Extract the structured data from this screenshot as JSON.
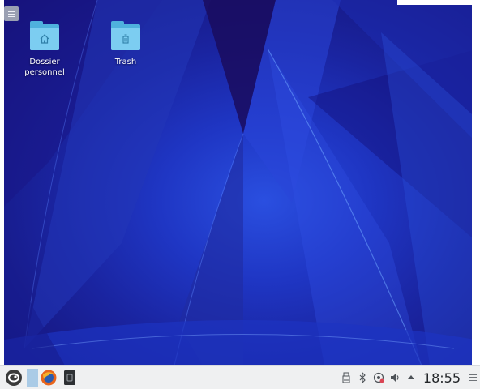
{
  "desktop": {
    "icons": [
      {
        "name": "Dossier personnel",
        "line1": "Dossier",
        "line2": "personnel",
        "icon": "home-icon"
      },
      {
        "name": "Trash",
        "line1": "Trash",
        "line2": "",
        "icon": "trash-icon"
      }
    ],
    "colors": {
      "folder": "#4fb1dd",
      "folder_front": "#7ccdf1",
      "wallpaper_base": "#1f36c4"
    }
  },
  "taskbar": {
    "launcher_icon": "opensuse-menu-icon",
    "apps": [
      {
        "name": "firefox",
        "icon": "firefox-icon"
      },
      {
        "name": "terminal",
        "icon": "terminal-icon"
      }
    ],
    "tray": [
      {
        "name": "storage",
        "icon": "storage-icon"
      },
      {
        "name": "bluetooth",
        "icon": "bluetooth-icon"
      },
      {
        "name": "network",
        "icon": "network-icon"
      },
      {
        "name": "volume",
        "icon": "volume-icon"
      },
      {
        "name": "expand",
        "icon": "chevron-up-icon"
      }
    ],
    "clock": "18:55"
  }
}
